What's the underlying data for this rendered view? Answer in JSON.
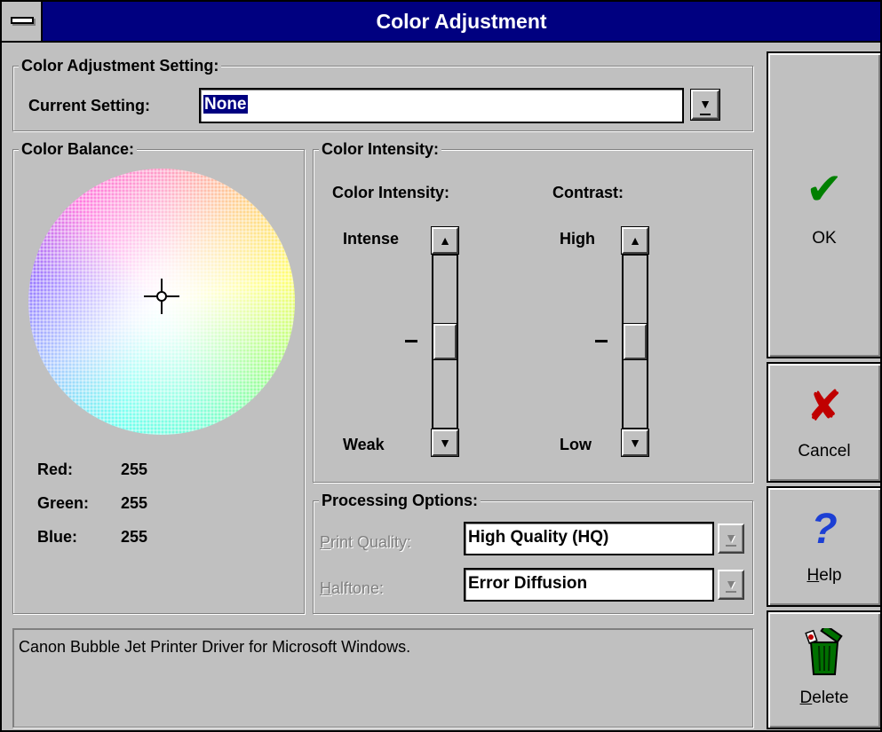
{
  "window": {
    "title": "Color Adjustment"
  },
  "adjustment_setting": {
    "legend": "Color Adjustment Setting:",
    "current_label": "Current Setting:",
    "current_value": "None"
  },
  "balance": {
    "legend": "Color Balance:",
    "red_label": "Red:",
    "red_value": "255",
    "green_label": "Green:",
    "green_value": "255",
    "blue_label": "Blue:",
    "blue_value": "255"
  },
  "intensity": {
    "legend": "Color Intensity:",
    "intensity_title": "Color Intensity:",
    "intensity_top": "Intense",
    "intensity_bottom": "Weak",
    "intensity_level": 0.5,
    "contrast_title": "Contrast:",
    "contrast_top": "High",
    "contrast_bottom": "Low",
    "contrast_level": 0.5
  },
  "processing": {
    "legend": "Processing Options:",
    "quality_label_pre": "P",
    "quality_label_rest": "rint Quality:",
    "quality_value": "High Quality (HQ)",
    "halftone_label_pre": "H",
    "halftone_label_rest": "alftone:",
    "halftone_value": "Error Diffusion"
  },
  "status_text": "Canon Bubble Jet Printer Driver for Microsoft Windows.",
  "buttons": {
    "ok": "OK",
    "cancel": "Cancel",
    "help_mn": "H",
    "help_rest": "elp",
    "delete_mn": "D",
    "delete_rest": "elete"
  },
  "icons": {
    "ok": "green-checkmark-icon",
    "cancel": "red-x-icon",
    "help": "question-mark-icon",
    "delete": "trash-can-icon",
    "system_menu": "system-menu-icon"
  },
  "colors": {
    "title_bar": "#000080",
    "ok_check": "#008000",
    "cancel_x": "#c00000",
    "help_q": "#1c3fd4",
    "trash": "#007000"
  }
}
